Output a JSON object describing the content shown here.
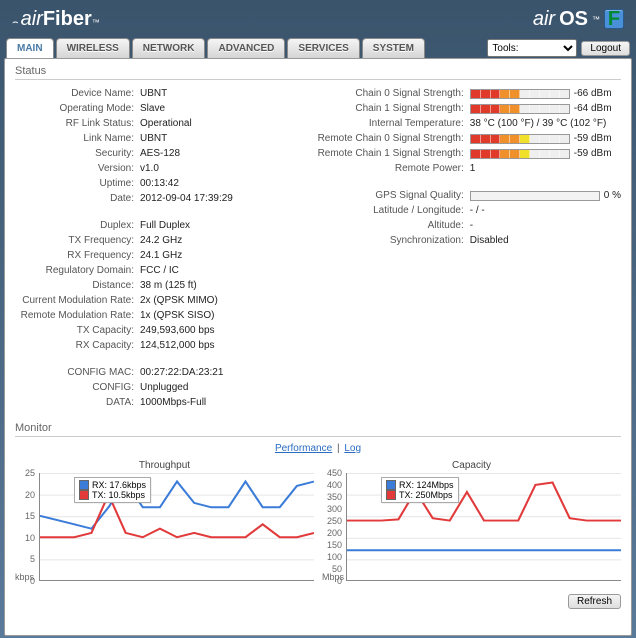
{
  "branding": {
    "left_air": "air",
    "left_fiber": "Fiber",
    "tm": "™",
    "right_air": "air",
    "right_os": "OS",
    "f_badge": "F"
  },
  "tabs": {
    "main": "MAIN",
    "wireless": "WIRELESS",
    "network": "NETWORK",
    "advanced": "ADVANCED",
    "services": "SERVICES",
    "system": "SYSTEM"
  },
  "toolbar": {
    "tools_placeholder": "Tools:",
    "logout": "Logout"
  },
  "sections": {
    "status": "Status",
    "monitor": "Monitor"
  },
  "status_left": {
    "device_name": {
      "label": "Device Name:",
      "value": "UBNT"
    },
    "operating_mode": {
      "label": "Operating Mode:",
      "value": "Slave"
    },
    "rf_link_status": {
      "label": "RF Link Status:",
      "value": "Operational"
    },
    "link_name": {
      "label": "Link Name:",
      "value": "UBNT"
    },
    "security": {
      "label": "Security:",
      "value": "AES-128"
    },
    "version": {
      "label": "Version:",
      "value": "v1.0"
    },
    "uptime": {
      "label": "Uptime:",
      "value": "00:13:42"
    },
    "date": {
      "label": "Date:",
      "value": "2012-09-04 17:39:29"
    },
    "duplex": {
      "label": "Duplex:",
      "value": "Full Duplex"
    },
    "tx_frequency": {
      "label": "TX Frequency:",
      "value": "24.2 GHz"
    },
    "rx_frequency": {
      "label": "RX Frequency:",
      "value": "24.1 GHz"
    },
    "regulatory_domain": {
      "label": "Regulatory Domain:",
      "value": "FCC / IC"
    },
    "distance": {
      "label": "Distance:",
      "value": "38 m (125 ft)"
    },
    "current_mod_rate": {
      "label": "Current Modulation Rate:",
      "value": "2x (QPSK MIMO)"
    },
    "remote_mod_rate": {
      "label": "Remote Modulation Rate:",
      "value": "1x (QPSK SISO)"
    },
    "tx_capacity": {
      "label": "TX Capacity:",
      "value": "249,593,600 bps"
    },
    "rx_capacity": {
      "label": "RX Capacity:",
      "value": "124,512,000 bps"
    },
    "config_mac": {
      "label": "CONFIG MAC:",
      "value": "00:27:22:DA:23:21"
    },
    "config": {
      "label": "CONFIG:",
      "value": "Unplugged"
    },
    "data": {
      "label": "DATA:",
      "value": "1000Mbps-Full"
    }
  },
  "status_right": {
    "chain0": {
      "label": "Chain 0 Signal Strength:",
      "value": "-66 dBm"
    },
    "chain1": {
      "label": "Chain 1 Signal Strength:",
      "value": "-64 dBm"
    },
    "internal_temp": {
      "label": "Internal Temperature:",
      "value": "38 °C (100 °F) / 39 °C (102 °F)"
    },
    "remote_chain0": {
      "label": "Remote Chain 0 Signal Strength:",
      "value": "-59 dBm"
    },
    "remote_chain1": {
      "label": "Remote Chain 1 Signal Strength:",
      "value": "-59 dBm"
    },
    "remote_power": {
      "label": "Remote Power:",
      "value": "1"
    },
    "gps_quality": {
      "label": "GPS Signal Quality:",
      "value": "0 %"
    },
    "lat_lon": {
      "label": "Latitude / Longitude:",
      "value": "- / -"
    },
    "altitude": {
      "label": "Altitude:",
      "value": "-"
    },
    "synchronization": {
      "label": "Synchronization:",
      "value": "Disabled"
    }
  },
  "monitor": {
    "link_performance": "Performance",
    "link_log": "Log",
    "refresh": "Refresh"
  },
  "chart_data": [
    {
      "type": "line",
      "title": "Throughput",
      "xunit": "kbps",
      "ylim": [
        0,
        25
      ],
      "yticks": [
        0,
        5,
        10,
        15,
        20,
        25
      ],
      "legend": {
        "rx": "RX: 17.6kbps",
        "tx": "TX: 10.5kbps"
      },
      "series": [
        {
          "name": "RX",
          "color": "#3a7cd8",
          "values": [
            15,
            14,
            13,
            12,
            17,
            23,
            17,
            17,
            23,
            18,
            17,
            17,
            23,
            17,
            17,
            22,
            23
          ]
        },
        {
          "name": "TX",
          "color": "#e23a3a",
          "values": [
            10,
            10,
            10,
            11,
            20,
            11,
            10,
            12,
            10,
            11,
            10,
            10,
            10,
            13,
            10,
            10,
            11
          ]
        }
      ]
    },
    {
      "type": "line",
      "title": "Capacity",
      "xunit": "Mbps",
      "ylim": [
        0,
        450
      ],
      "yticks": [
        0,
        50,
        100,
        150,
        200,
        250,
        300,
        350,
        400,
        450
      ],
      "legend": {
        "rx": "RX: 124Mbps",
        "tx": "TX: 250Mbps"
      },
      "series": [
        {
          "name": "RX",
          "color": "#3a7cd8",
          "values": [
            125,
            125,
            125,
            125,
            125,
            125,
            125,
            125,
            125,
            125,
            125,
            125,
            125,
            125,
            125,
            125,
            125
          ]
        },
        {
          "name": "TX",
          "color": "#e23a3a",
          "values": [
            250,
            250,
            250,
            255,
            375,
            260,
            250,
            370,
            250,
            250,
            250,
            400,
            410,
            260,
            250,
            250,
            250
          ]
        }
      ]
    }
  ]
}
